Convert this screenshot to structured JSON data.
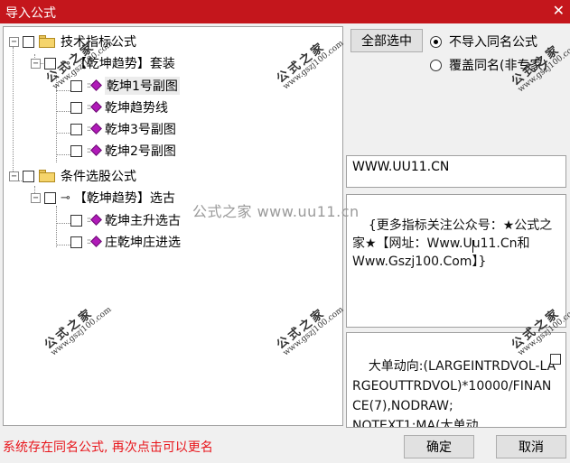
{
  "window": {
    "title": "导入公式",
    "close_glyph": "✕"
  },
  "tree": {
    "groups": [
      {
        "label": "技术指标公式",
        "children": [
          {
            "label": "【乾坤趋势】套装",
            "children": [
              "乾坤1号副图",
              "乾坤趋势线",
              "乾坤3号副图",
              "乾坤2号副图"
            ]
          }
        ]
      },
      {
        "label": "条件选股公式",
        "children": [
          {
            "label": "【乾坤趋势】选古",
            "children": [
              "乾坤主升选古",
              "庄乾坤庄进选"
            ]
          }
        ]
      }
    ],
    "expander_glyph": "−",
    "key_glyph": "⊸"
  },
  "select_all_button": "全部选中",
  "radios": [
    {
      "label": "不导入同名公式",
      "selected": true
    },
    {
      "label": "覆盖同名(非专家)",
      "selected": false
    }
  ],
  "url_field": "WWW.UU11.CN",
  "description": "{更多指标关注公众号：★公式之家★【网址：Www.Uu11.Cn和Www.Gszj100.Com】}",
  "code_preview": "大单动向:(LARGEINTRDVOL-LARGEOUTTRDVOL)*10000/FINANCE(7),NODRAW;\nNOTEXT1:MA(大单动",
  "status_message": "系统存在同名公式, 再次点击可以更名",
  "ok_button": "确定",
  "cancel_button": "取消",
  "watermark": {
    "title": "公式之家",
    "site": "www.gszj100.com",
    "center_text": "公式之家 www.uu11.cn"
  }
}
